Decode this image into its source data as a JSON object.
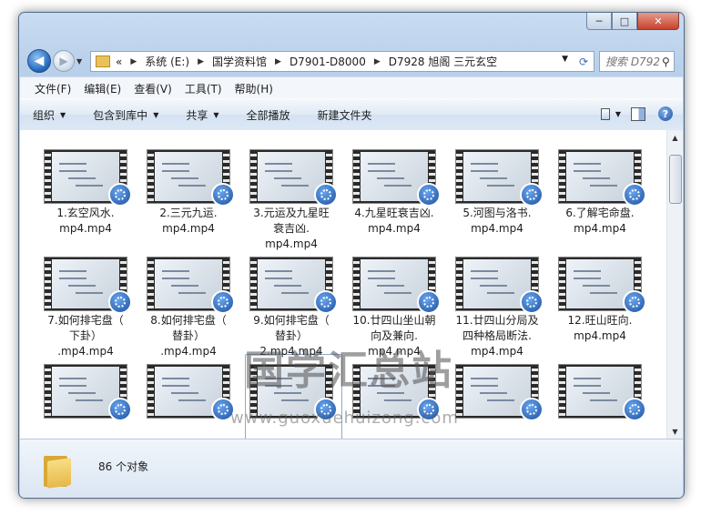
{
  "window": {
    "min_glyph": "─",
    "max_glyph": "□",
    "close_glyph": "✕"
  },
  "nav": {
    "back_glyph": "◀",
    "fwd_glyph": "▶"
  },
  "address": {
    "prefix": "«",
    "crumbs": [
      "系统 (E:)",
      "国学资料馆",
      "D7901-D8000",
      "D7928 旭阁 三元玄空"
    ]
  },
  "search": {
    "placeholder": "搜索 D792..."
  },
  "menu": [
    "文件(F)",
    "编辑(E)",
    "查看(V)",
    "工具(T)",
    "帮助(H)"
  ],
  "toolbar": {
    "organize": "组织",
    "include": "包含到库中",
    "share": "共享",
    "playall": "全部播放",
    "newfolder": "新建文件夹",
    "help": "?"
  },
  "files": [
    {
      "name": "1.玄空风水.\nmp4.mp4"
    },
    {
      "name": "2.三元九运.\nmp4.mp4"
    },
    {
      "name": "3.元运及九星旺\n衰吉凶.\nmp4.mp4"
    },
    {
      "name": "4.九星旺衰吉凶.\nmp4.mp4"
    },
    {
      "name": "5.河图与洛书.\nmp4.mp4"
    },
    {
      "name": "6.了解宅命盘.\nmp4.mp4"
    },
    {
      "name": "7.如何排宅盘（\n下卦）\n.mp4.mp4"
    },
    {
      "name": "8.如何排宅盘（\n替卦）\n.mp4.mp4"
    },
    {
      "name": "9.如何排宅盘（\n替卦）\n2.mp4.mp4"
    },
    {
      "name": "10.廿四山坐山朝\n向及兼向.\nmp4.mp4"
    },
    {
      "name": "11.廿四山分局及\n四种格局断法.\nmp4.mp4"
    },
    {
      "name": "12.旺山旺向.\nmp4.mp4"
    },
    {
      "name": ""
    },
    {
      "name": ""
    },
    {
      "name": ""
    },
    {
      "name": ""
    },
    {
      "name": ""
    },
    {
      "name": ""
    }
  ],
  "watermark": {
    "title": "国学汇总站",
    "url": "www.guoxuehuizong.com"
  },
  "status": {
    "count": "86 个对象"
  }
}
